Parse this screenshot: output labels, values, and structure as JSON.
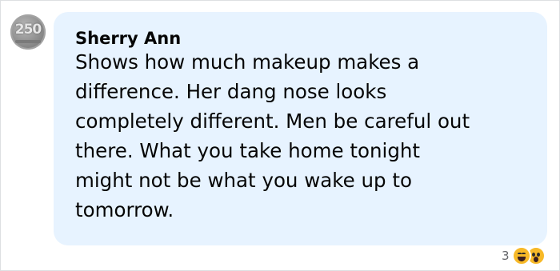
{
  "comment": {
    "avatar_icon": "profile-avatar",
    "avatar_text": "250",
    "author": "Sherry Ann",
    "text": "Shows how much makeup makes a\ndifference. Her dang nose looks\ncompletely different. Men be careful out\nthere. What you take home tonight\nmight not be what you wake up to\ntomorrow.",
    "bubble_color": "#e7f3ff"
  },
  "reactions": {
    "count": "3",
    "icons": [
      "haha-emoji-icon",
      "wow-emoji-icon"
    ]
  }
}
